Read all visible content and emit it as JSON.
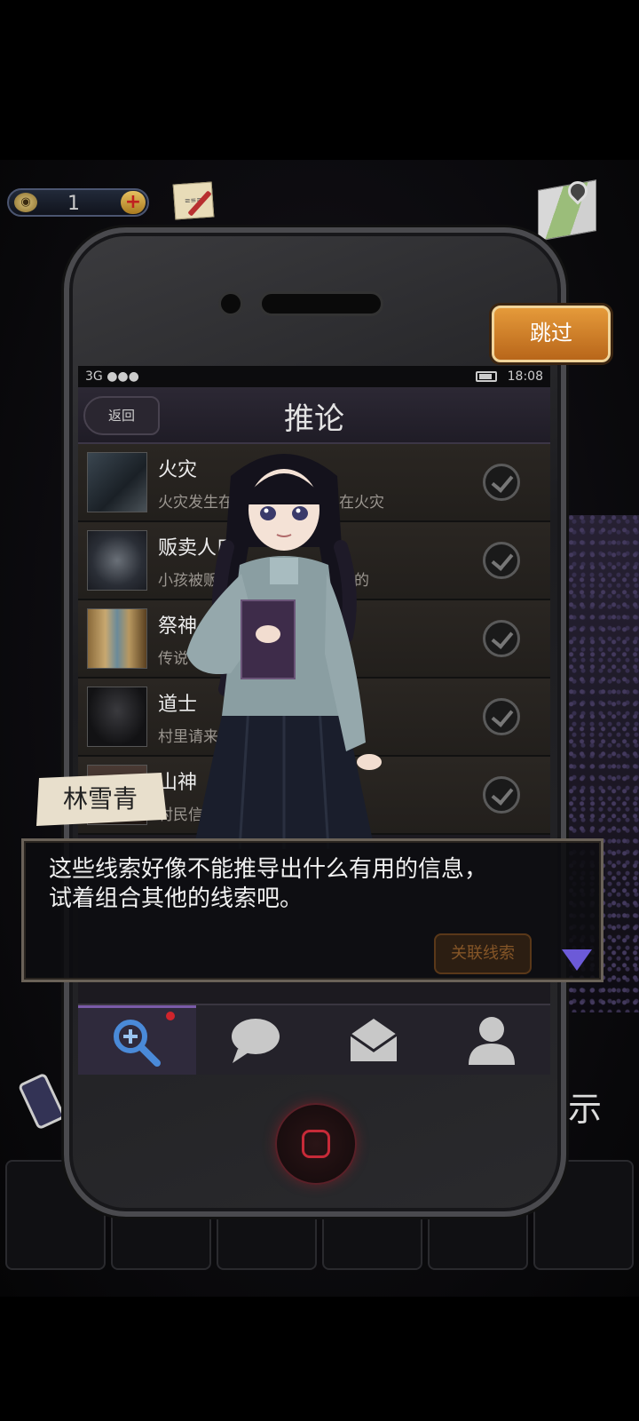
{
  "hud": {
    "coins": "1",
    "coin_plus": "+",
    "note_icon": "note-pen-icon",
    "map_icon": "map-pin-icon"
  },
  "phone": {
    "status": {
      "network": "3G ●●●",
      "time": "18:08"
    },
    "nav": {
      "back_label": "返回",
      "title": "推论"
    },
    "clues": [
      {
        "name": "火灾",
        "desc": "火灾发生在仪式举办当天，在火灾",
        "checked": true
      },
      {
        "name": "贩卖人口",
        "desc": "小孩被贩卖，因为村民们所谓的",
        "checked": true
      },
      {
        "name": "祭神",
        "desc": "传说中村内的祭神仪式，和小",
        "checked": true
      },
      {
        "name": "道士",
        "desc": "村里请来的道士，在村内的",
        "checked": true
      },
      {
        "name": "山神",
        "desc": "村民信奉着名为瑜山神的山",
        "checked": true
      }
    ],
    "tabs": [
      {
        "icon": "magnifier-plus-icon",
        "active": true
      },
      {
        "icon": "chat-bubble-icon",
        "active": false
      },
      {
        "icon": "envelope-icon",
        "active": false
      },
      {
        "icon": "user-icon",
        "active": false
      }
    ]
  },
  "skip_label": "跳过",
  "hint_fragment": "示",
  "dialog": {
    "speaker": "林雪青",
    "line1": "这些线索好像不能推导出什么有用的信息，",
    "line2": "试着组合其他的线索吧。",
    "ghost_button": "关联线索"
  },
  "colors": {
    "skip": "#d0842c",
    "accent_purple": "#6c5ad8",
    "home_red": "#c62a38"
  }
}
